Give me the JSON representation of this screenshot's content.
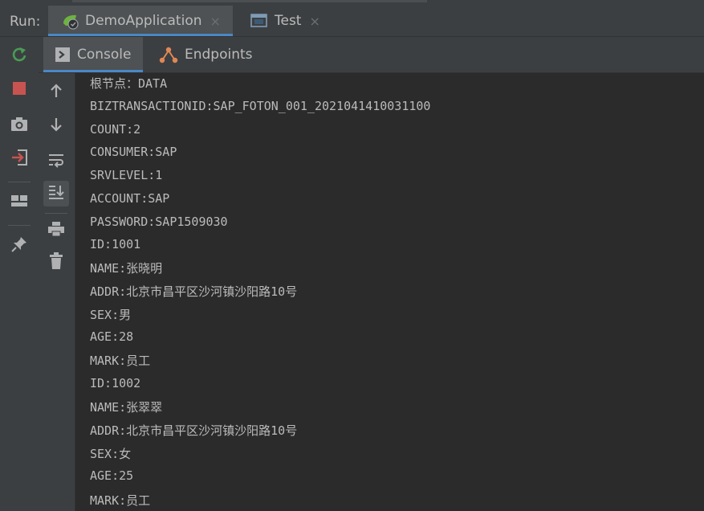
{
  "run_bar": {
    "label": "Run:",
    "tabs": [
      {
        "label": "DemoApplication",
        "active": true,
        "close": "×"
      },
      {
        "label": "Test",
        "active": false,
        "close": "×"
      }
    ]
  },
  "inner_tabs": [
    {
      "label": "Console",
      "active": true
    },
    {
      "label": "Endpoints",
      "active": false
    }
  ],
  "left_toolbar": [
    "rerun-icon",
    "stop-icon",
    "camera-icon",
    "exit-icon",
    "layout-icon",
    "pin-icon"
  ],
  "side_toolbar": [
    "up-arrow-icon",
    "down-arrow-icon",
    "soft-wrap-icon",
    "scroll-to-end-icon",
    "print-icon",
    "trash-icon"
  ],
  "console_lines": [
    "根节点：DATA",
    "BIZTRANSACTIONID:SAP_FOTON_001_2021041410031100",
    "COUNT:2",
    "CONSUMER:SAP",
    "SRVLEVEL:1",
    "ACCOUNT:SAP",
    "PASSWORD:SAP1509030",
    "ID:1001",
    "NAME:张晓明",
    "ADDR:北京市昌平区沙河镇沙阳路10号",
    "SEX:男",
    "AGE:28",
    "MARK:员工",
    "ID:1002",
    "NAME:张翠翠",
    "ADDR:北京市昌平区沙河镇沙阳路10号",
    "SEX:女",
    "AGE:25",
    "MARK:员工"
  ],
  "colors": {
    "background": "#2b2b2b",
    "toolbar": "#3c3f41",
    "accent": "#4a88c7",
    "text": "#bbbbbb",
    "green": "#499c54",
    "red": "#c75450"
  }
}
